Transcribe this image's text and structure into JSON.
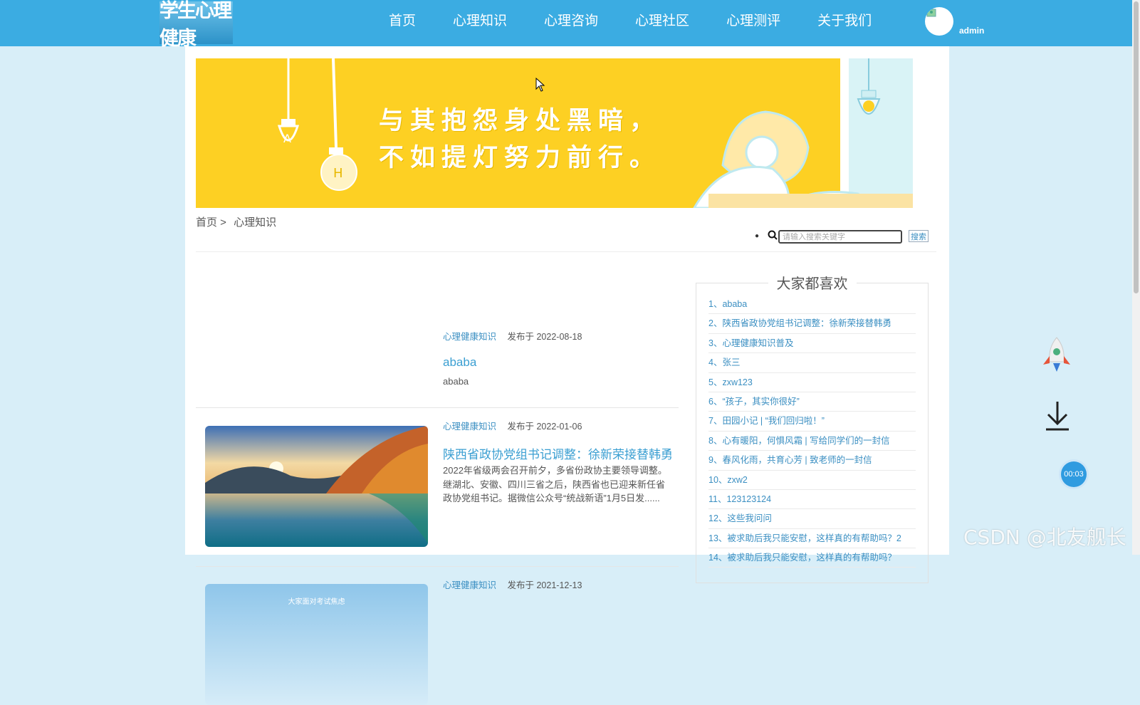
{
  "header": {
    "logo_text": "学生心理健康",
    "nav": [
      "首页",
      "心理知识",
      "心理咨询",
      "心理社区",
      "心理测评",
      "关于我们"
    ],
    "username": "admin"
  },
  "banner": {
    "line1": "与其抱怨身处黑暗，",
    "line2": "不如提灯努力前行。"
  },
  "breadcrumb": {
    "home": "首页 >",
    "current": "心理知识"
  },
  "search": {
    "placeholder": "请输入搜索关键字",
    "button": "搜索"
  },
  "articles": [
    {
      "category": "心理健康知识",
      "date": "发布于 2022-08-18",
      "title": "ababa",
      "desc": "ababa"
    },
    {
      "category": "心理健康知识",
      "date": "发布于 2022-01-06",
      "title": "陕西省政协党组书记调整：徐新荣接替韩勇",
      "desc": "2022年省级两会召开前夕，多省份政协主要领导调整。继湖北、安徽、四川三省之后，陕西省也已迎来新任省政协党组书记。据微信公众号“统战新语”1月5日发......"
    },
    {
      "category": "心理健康知识",
      "date": "发布于 2021-12-13",
      "thumb_caption": "大家面对考试焦虑"
    }
  ],
  "sidebar": {
    "title": "大家都喜欢",
    "items": [
      "1、ababa",
      "2、陕西省政协党组书记调整：徐新荣接替韩勇",
      "3、心理健康知识普及",
      "4、张三",
      "5、zxw123",
      "6、“孩子，其实你很好”",
      "7、田园小记 | “我们回归啦！”",
      "8、心有暖阳，何惧风霜 | 写给同学们的一封信",
      "9、春风化雨，共育心芳 | 致老师的一封信",
      "10、zxw2",
      "11、123123124",
      "12、这些我问问",
      "13、被求助后我只能安慰，这样真的有帮助吗？2",
      "14、被求助后我只能安慰，这样真的有帮助吗？"
    ]
  },
  "widgets": {
    "timer": "00:03"
  },
  "watermark": "CSDN @北友舰长"
}
